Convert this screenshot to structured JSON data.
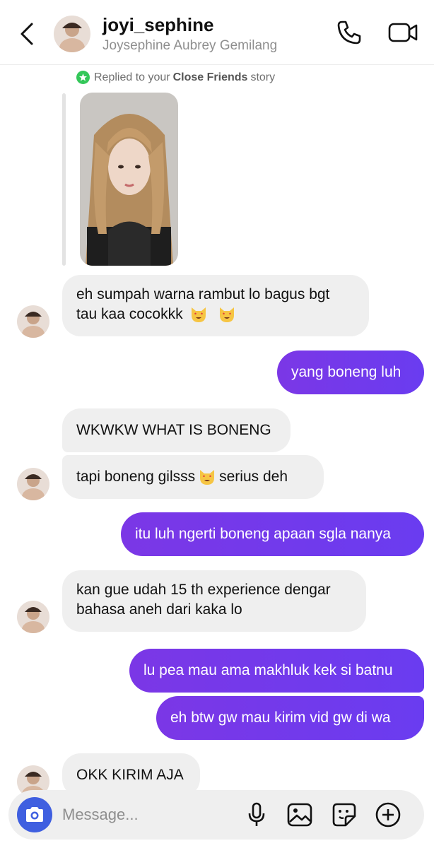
{
  "header": {
    "username": "joyi_sephine",
    "full_name": "Joysephine Aubrey Gemilang",
    "icons": [
      "back-chevron-icon",
      "avatar",
      "phone-icon",
      "video-camera-icon"
    ]
  },
  "story_reply": {
    "prefix": "Replied to your",
    "highlight": "Close Friends",
    "suffix": "story"
  },
  "messages": [
    {
      "from": "them",
      "line1": "eh sumpah warna rambut lo bagus bgt",
      "line2": "tau kaa cocokkk"
    },
    {
      "from": "me",
      "text": "yang boneng luh"
    },
    {
      "from": "them",
      "text": "WKWKW WHAT IS BONENG"
    },
    {
      "from": "them",
      "pre": "tapi boneng gilsss",
      "post": "serius deh"
    },
    {
      "from": "me",
      "text": "itu luh ngerti boneng apaan sgla nanya"
    },
    {
      "from": "them",
      "line1": "kan gue udah 15 th experience dengar",
      "line2": "bahasa aneh dari kaka lo"
    },
    {
      "from": "me",
      "text": "lu pea mau ama makhluk kek si batnu"
    },
    {
      "from": "me",
      "text": "eh btw gw mau kirim vid gw di wa"
    },
    {
      "from": "them",
      "text": "OKK KIRIM AJA"
    }
  ],
  "composer": {
    "placeholder": "Message...",
    "icons": [
      "camera-icon",
      "microphone-icon",
      "gallery-icon",
      "sticker-icon",
      "plus-icon"
    ]
  },
  "colors": {
    "outgoing_bubble": "#6f3aec",
    "incoming_bubble": "#efefef",
    "camera_button": "#3f5fe0",
    "close_friends_star": "#34c759"
  }
}
